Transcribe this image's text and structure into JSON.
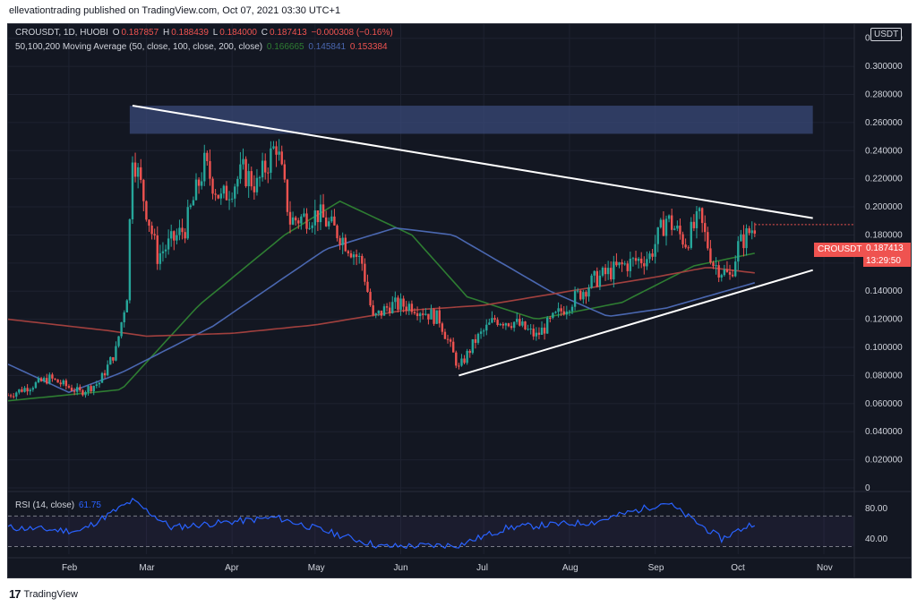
{
  "header": {
    "publisher_line": "ellevationtrading published on TradingView.com, Oct 07, 2021 03:30 UTC+1"
  },
  "legend": {
    "symbol_line": "CROUSDT, 1D, HUOBI",
    "o_label": "O",
    "o_value": "0.187857",
    "h_label": "H",
    "h_value": "0.188439",
    "l_label": "L",
    "l_value": "0.184000",
    "c_label": "C",
    "c_value": "0.187413",
    "change": "−0.000308 (−0.16%)",
    "ma_line": "50,100,200 Moving Average (50, close, 100, close, 200, close)",
    "ma50": "0.166665",
    "ma100": "0.145841",
    "ma200": "0.153384"
  },
  "rsi_legend": {
    "label": "RSI (14, close)",
    "value": "61.75"
  },
  "price_tag": {
    "symbol": "CROUSDT",
    "price": "0.187413",
    "countdown": "13:29:50"
  },
  "currency_badge": "USDT",
  "footer": {
    "brand": "TradingView"
  },
  "colors": {
    "background": "#131722",
    "up": "#26a69a",
    "down": "#ef5350",
    "ma50": "#2e7d32",
    "ma100": "#4a67b0",
    "ma200": "#a1403e",
    "rsi": "#2962ff",
    "zone": "#3a4a78",
    "trendline": "#ffffff"
  },
  "chart_data": {
    "type": "candlestick",
    "title": "CROUSDT, 1D, HUOBI",
    "y_axis": {
      "ticks": [
        "0.320000",
        "0.300000",
        "0.280000",
        "0.260000",
        "0.240000",
        "0.220000",
        "0.200000",
        "0.180000",
        "0.160000",
        "0.140000",
        "0.120000",
        "0.100000",
        "0.080000",
        "0.060000",
        "0.040000",
        "0.020000",
        "0"
      ],
      "ylim": [
        0,
        0.33
      ]
    },
    "x_axis": {
      "ticks": [
        "Feb",
        "Mar",
        "Apr",
        "May",
        "Jun",
        "Jul",
        "Aug",
        "Sep",
        "Oct",
        "Nov"
      ],
      "range": [
        "2021-01-10",
        "2021-11-12"
      ]
    },
    "candles": {
      "start": "2021-01-10",
      "end": "2021-10-07",
      "close_keypoints": [
        [
          "2021-01-10",
          0.066
        ],
        [
          "2021-01-25",
          0.078
        ],
        [
          "2021-02-05",
          0.068
        ],
        [
          "2021-02-12",
          0.075
        ],
        [
          "2021-02-18",
          0.098
        ],
        [
          "2021-02-22",
          0.138
        ],
        [
          "2021-02-24",
          0.24
        ],
        [
          "2021-03-05",
          0.165
        ],
        [
          "2021-03-15",
          0.185
        ],
        [
          "2021-03-22",
          0.23
        ],
        [
          "2021-03-28",
          0.205
        ],
        [
          "2021-04-05",
          0.225
        ],
        [
          "2021-04-10",
          0.215
        ],
        [
          "2021-04-17",
          0.245
        ],
        [
          "2021-04-22",
          0.19
        ],
        [
          "2021-05-02",
          0.195
        ],
        [
          "2021-05-10",
          0.18
        ],
        [
          "2021-05-18",
          0.16
        ],
        [
          "2021-05-22",
          0.12
        ],
        [
          "2021-05-28",
          0.13
        ],
        [
          "2021-06-05",
          0.13
        ],
        [
          "2021-06-15",
          0.12
        ],
        [
          "2021-06-22",
          0.085
        ],
        [
          "2021-06-28",
          0.105
        ],
        [
          "2021-07-05",
          0.12
        ],
        [
          "2021-07-12",
          0.118
        ],
        [
          "2021-07-20",
          0.108
        ],
        [
          "2021-07-30",
          0.128
        ],
        [
          "2021-08-10",
          0.148
        ],
        [
          "2021-08-20",
          0.158
        ],
        [
          "2021-08-30",
          0.165
        ],
        [
          "2021-09-05",
          0.192
        ],
        [
          "2021-09-12",
          0.175
        ],
        [
          "2021-09-17",
          0.192
        ],
        [
          "2021-09-22",
          0.16
        ],
        [
          "2021-09-28",
          0.15
        ],
        [
          "2021-10-01",
          0.172
        ],
        [
          "2021-10-07",
          0.187
        ]
      ]
    },
    "moving_averages": [
      {
        "name": "50",
        "keypoints": [
          [
            "2021-01-10",
            0.062
          ],
          [
            "2021-02-20",
            0.07
          ],
          [
            "2021-03-20",
            0.13
          ],
          [
            "2021-04-20",
            0.18
          ],
          [
            "2021-05-10",
            0.204
          ],
          [
            "2021-06-05",
            0.18
          ],
          [
            "2021-06-25",
            0.136
          ],
          [
            "2021-07-20",
            0.12
          ],
          [
            "2021-08-20",
            0.132
          ],
          [
            "2021-09-15",
            0.158
          ],
          [
            "2021-10-07",
            0.167
          ]
        ]
      },
      {
        "name": "100",
        "keypoints": [
          [
            "2021-01-10",
            0.088
          ],
          [
            "2021-02-01",
            0.068
          ],
          [
            "2021-02-20",
            0.082
          ],
          [
            "2021-03-25",
            0.115
          ],
          [
            "2021-05-05",
            0.17
          ],
          [
            "2021-05-30",
            0.185
          ],
          [
            "2021-06-20",
            0.18
          ],
          [
            "2021-07-25",
            0.14
          ],
          [
            "2021-08-15",
            0.122
          ],
          [
            "2021-09-05",
            0.128
          ],
          [
            "2021-10-07",
            0.146
          ]
        ]
      },
      {
        "name": "200",
        "keypoints": [
          [
            "2021-01-10",
            0.12
          ],
          [
            "2021-02-15",
            0.112
          ],
          [
            "2021-03-01",
            0.108
          ],
          [
            "2021-04-01",
            0.11
          ],
          [
            "2021-05-01",
            0.116
          ],
          [
            "2021-06-01",
            0.126
          ],
          [
            "2021-07-01",
            0.13
          ],
          [
            "2021-08-01",
            0.14
          ],
          [
            "2021-09-01",
            0.15
          ],
          [
            "2021-09-20",
            0.157
          ],
          [
            "2021-10-07",
            0.153
          ]
        ]
      }
    ],
    "drawings": {
      "resistance_zone": {
        "from": "2021-02-23",
        "to": "2021-10-28",
        "low": 0.252,
        "high": 0.272
      },
      "upper_trendline": [
        [
          "2021-02-24",
          0.272
        ],
        [
          "2021-10-28",
          0.192
        ]
      ],
      "lower_trendline": [
        [
          "2021-06-22",
          0.08
        ],
        [
          "2021-10-28",
          0.155
        ]
      ]
    },
    "rsi": {
      "ticks": [
        "80.00",
        "40.00"
      ],
      "levels": [
        70,
        30
      ],
      "ylim": [
        20,
        95
      ],
      "keypoints": [
        [
          "2021-01-10",
          55
        ],
        [
          "2021-02-05",
          50
        ],
        [
          "2021-02-24",
          90
        ],
        [
          "2021-03-10",
          55
        ],
        [
          "2021-04-17",
          68
        ],
        [
          "2021-05-10",
          45
        ],
        [
          "2021-05-25",
          30
        ],
        [
          "2021-06-22",
          32
        ],
        [
          "2021-07-10",
          55
        ],
        [
          "2021-08-10",
          62
        ],
        [
          "2021-09-05",
          88
        ],
        [
          "2021-09-25",
          40
        ],
        [
          "2021-10-07",
          61.75
        ]
      ]
    }
  }
}
